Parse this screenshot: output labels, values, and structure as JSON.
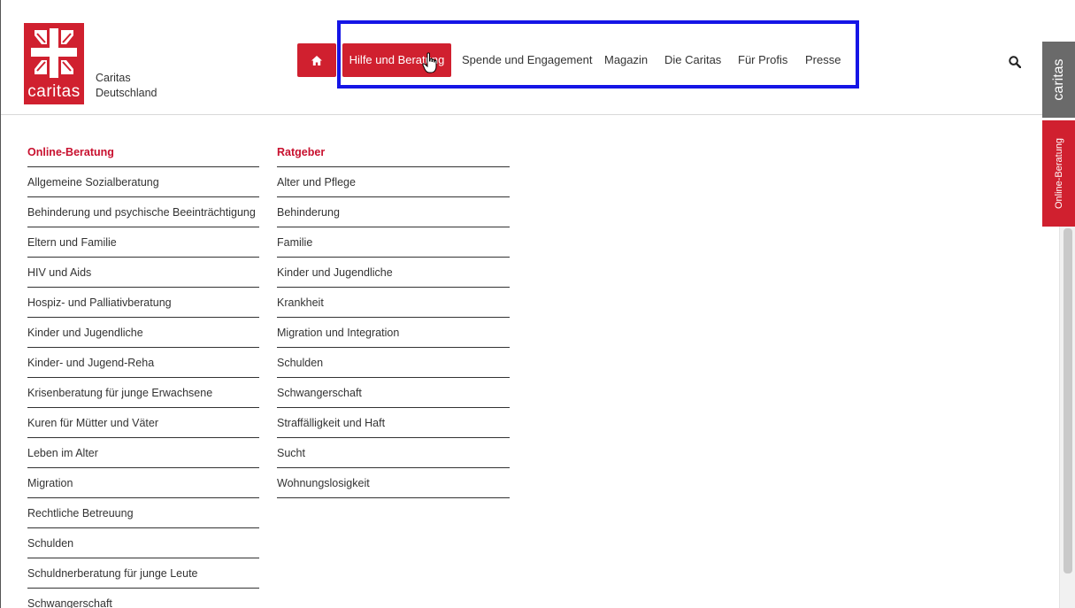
{
  "brand": {
    "logo_word": "caritas",
    "org_name_line1": "Caritas",
    "org_name_line2": "Deutschland",
    "color_primary": "#d0202f"
  },
  "nav": {
    "home_icon": "home-icon",
    "active": "Hilfe und Beratung",
    "items": [
      "Spende und Engagement",
      "Magazin",
      "Die Caritas",
      "Für Profis",
      "Presse"
    ]
  },
  "search": {
    "icon": "search-icon"
  },
  "side_tabs": {
    "caritas": "caritas",
    "online": "Online-Beratung"
  },
  "columns": [
    {
      "heading": "Online-Beratung",
      "items": [
        "Allgemeine Sozialberatung",
        "Behinderung und psychische Beeinträchtigung",
        "Eltern und Familie",
        "HIV und Aids",
        "Hospiz- und Palliativberatung",
        "Kinder und Jugendliche",
        "Kinder- und Jugend-Reha",
        "Krisenberatung für junge Erwachsene",
        "Kuren für Mütter und Väter",
        "Leben im Alter",
        "Migration",
        "Rechtliche Betreuung",
        "Schulden",
        "Schuldnerberatung für junge Leute",
        "Schwangerschaft"
      ]
    },
    {
      "heading": "Ratgeber",
      "items": [
        "Alter und Pflege",
        "Behinderung",
        "Familie",
        "Kinder und Jugendliche",
        "Krankheit",
        "Migration und Integration",
        "Schulden",
        "Schwangerschaft",
        "Straffälligkeit und Haft",
        "Sucht",
        "Wohnungslosigkeit"
      ]
    }
  ]
}
